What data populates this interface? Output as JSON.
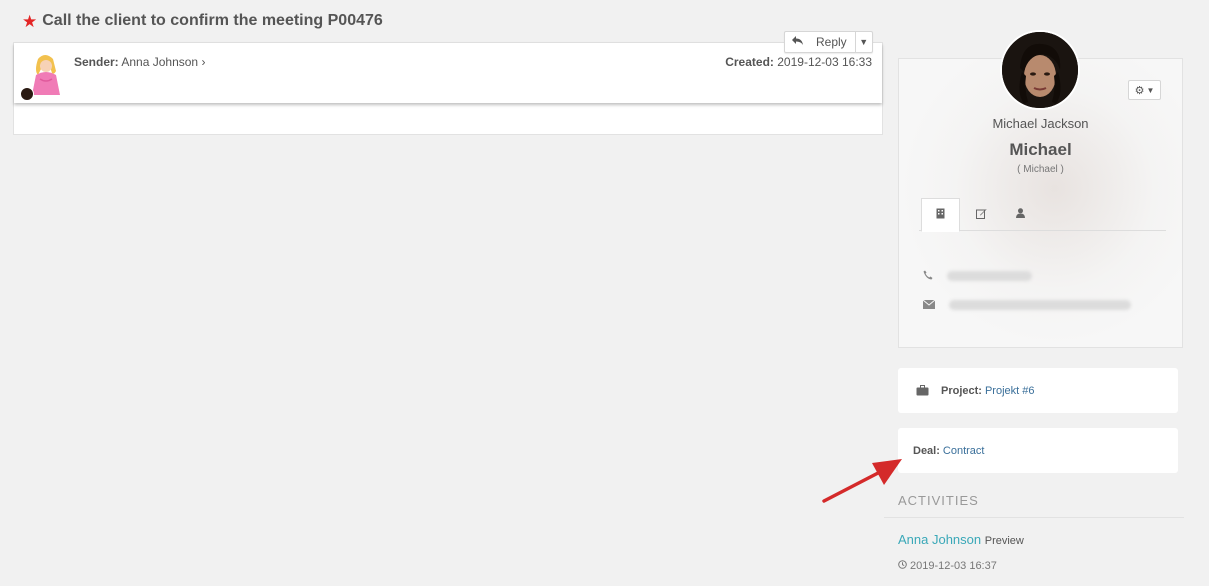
{
  "ticket": {
    "title": "Call the client to confirm the meeting P00476"
  },
  "message": {
    "sender_label": "Sender:",
    "sender_name": "Anna Johnson",
    "created_label": "Created:",
    "created_value": "2019-12-03 16:33",
    "reply_label": "Reply"
  },
  "profile": {
    "full_name": "Michael Jackson",
    "nickname": "Michael",
    "nickname_sub": "( Michael )"
  },
  "project": {
    "label": "Project:",
    "value": "Projekt #6"
  },
  "deal": {
    "label": "Deal:",
    "value": "Contract"
  },
  "activities": {
    "heading": "ACTIVITIES",
    "items": [
      {
        "who": "Anna Johnson",
        "what": "Preview",
        "time": "2019-12-03 16:37"
      }
    ]
  },
  "colors": {
    "star": "#e32525",
    "link": "#3a6f9a",
    "activity_link": "#3aa8b8",
    "annotation_arrow": "#d42a2a"
  }
}
